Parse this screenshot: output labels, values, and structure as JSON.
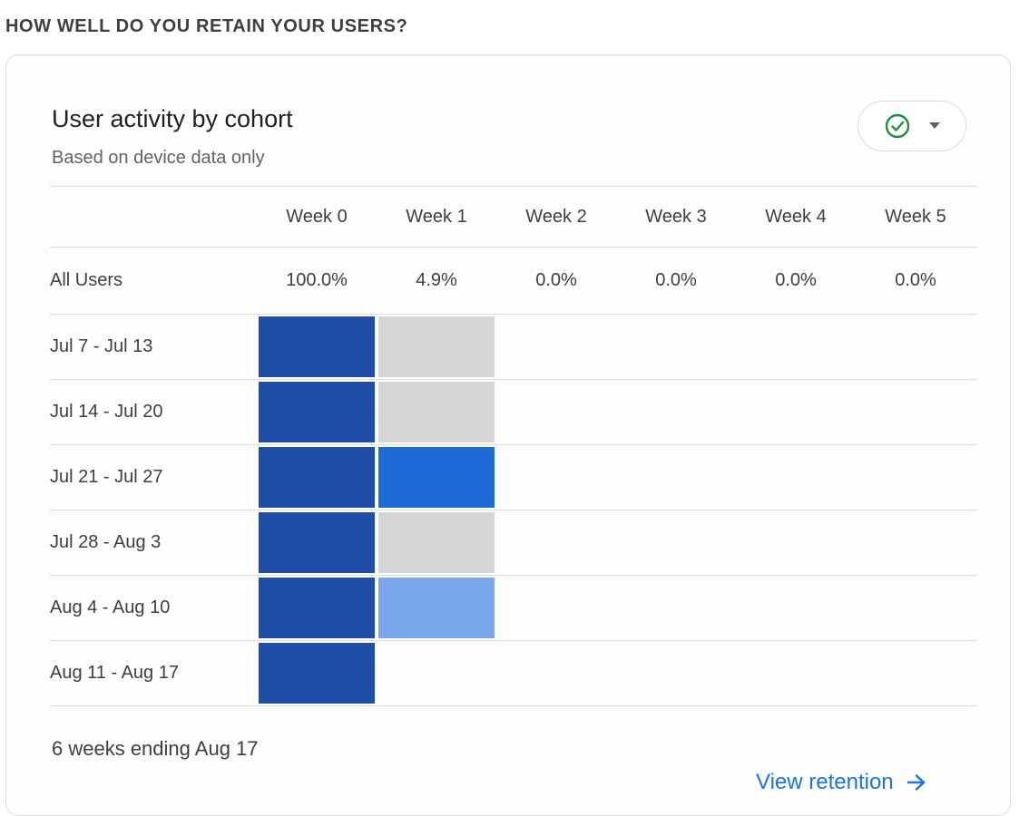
{
  "section": {
    "heading": "HOW WELL DO YOU RETAIN YOUR USERS?"
  },
  "card": {
    "title": "User activity by cohort",
    "subtitle": "Based on device data only",
    "footer": "6 weeks ending Aug 17",
    "view_link_label": "View retention"
  },
  "table": {
    "weeks": [
      "Week 0",
      "Week 1",
      "Week 2",
      "Week 3",
      "Week 4",
      "Week 5"
    ],
    "summary": {
      "label": "All Users",
      "values": [
        "100.0%",
        "4.9%",
        "0.0%",
        "0.0%",
        "0.0%",
        "0.0%"
      ]
    },
    "cohorts": [
      {
        "label": "Jul 7 - Jul 13",
        "cells": [
          "#1e4fa8",
          "#d5d5d5",
          "",
          "",
          "",
          ""
        ]
      },
      {
        "label": "Jul 14 - Jul 20",
        "cells": [
          "#1e4fa8",
          "#d5d5d5",
          "",
          "",
          "",
          ""
        ]
      },
      {
        "label": "Jul 21 - Jul 27",
        "cells": [
          "#1e4fa8",
          "#1e6ad6",
          "",
          "",
          "",
          ""
        ]
      },
      {
        "label": "Jul 28 - Aug 3",
        "cells": [
          "#1e4fa8",
          "#d5d5d5",
          "",
          "",
          "",
          ""
        ]
      },
      {
        "label": "Aug 4 - Aug 10",
        "cells": [
          "#1e4fa8",
          "#7aa7ee",
          "",
          "",
          "",
          ""
        ]
      },
      {
        "label": "Aug 11 - Aug 17",
        "cells": [
          "#1e4fa8",
          "",
          "",
          "",
          "",
          ""
        ]
      }
    ]
  },
  "colors": {
    "accent": "#1a73e8",
    "check_green": "#1e8e3e"
  },
  "icons": {
    "compare": "check-circle-icon",
    "dropdown": "caret-down-icon",
    "link_arrow": "arrow-right-icon"
  }
}
